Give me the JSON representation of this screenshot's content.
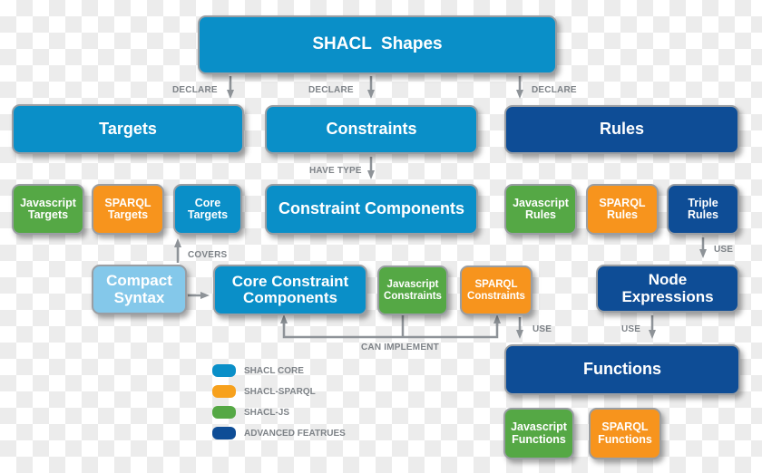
{
  "nodes": {
    "shacl_shapes": "SHACL  Shapes",
    "targets": "Targets",
    "constraints": "Constraints",
    "rules": "Rules",
    "javascript_targets": "Javascript\nTargets",
    "sparql_targets": "SPARQL\nTargets",
    "core_targets": "Core\nTargets",
    "constraint_components": "Constraint Components",
    "javascript_rules": "Javascript\nRules",
    "sparql_rules": "SPARQL\nRules",
    "triple_rules": "Triple\nRules",
    "compact_syntax": "Compact\nSyntax",
    "core_constraint_components": "Core Constraint\nComponents",
    "javascript_constraints": "Javascript\nConstraints",
    "sparql_constraints": "SPARQL\nConstraints",
    "node_expressions": "Node\nExpressions",
    "functions": "Functions",
    "javascript_functions": "Javascript\nFunctions",
    "sparql_functions": "SPARQL\nFunctions"
  },
  "edge_labels": {
    "declare_targets": "DECLARE",
    "declare_constraints": "DECLARE",
    "declare_rules": "DECLARE",
    "have_type": "HAVE TYPE",
    "covers": "COVERS",
    "use_triple": "USE",
    "use_sparql_constraints": "USE",
    "use_node_expressions": "USE",
    "can_implement": "CAN IMPLEMENT"
  },
  "legend": [
    {
      "label": "SHACL CORE",
      "color": "#0a8fc8"
    },
    {
      "label": "SHACL-SPARQL",
      "color": "#f7941d"
    },
    {
      "label": "SHACL-JS",
      "color": "#55a845"
    },
    {
      "label": "ADVANCED FEATRUES",
      "color": "#0e4d96"
    }
  ]
}
